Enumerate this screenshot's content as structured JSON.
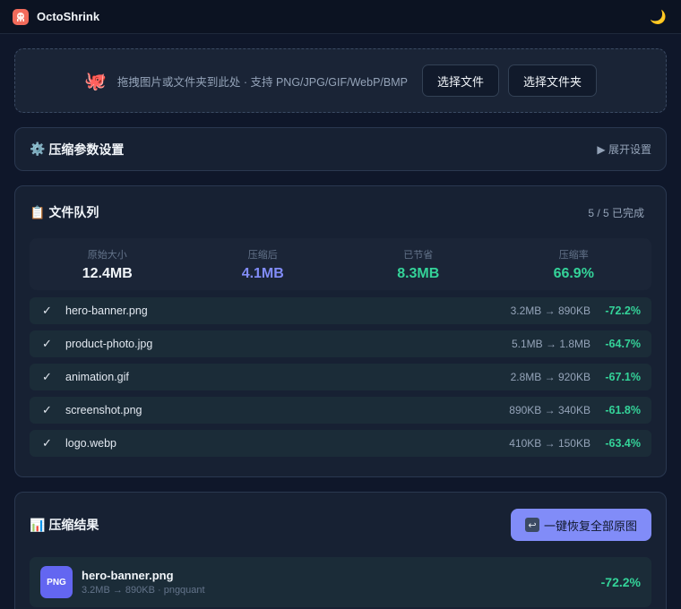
{
  "app": {
    "title": "OctoShrink",
    "theme_icon": "moon-icon"
  },
  "dropzone": {
    "icon": "octopus-icon",
    "text": "拖拽图片或文件夹到此处 · 支持 PNG/JPG/GIF/WebP/BMP",
    "select_file": "选择文件",
    "select_folder": "选择文件夹"
  },
  "settings": {
    "icon": "gear-icon",
    "title": "压缩参数设置",
    "expand": "▶ 展开设置"
  },
  "queue": {
    "icon": "clipboard-icon",
    "title": "文件队列",
    "count": "5 / 5 已完成",
    "stats": [
      {
        "label": "原始大小",
        "value": "12.4MB",
        "color": "#f1f5f9"
      },
      {
        "label": "压缩后",
        "value": "4.1MB",
        "color": "#818cf8"
      },
      {
        "label": "已节省",
        "value": "8.3MB",
        "color": "#34d399"
      },
      {
        "label": "压缩率",
        "value": "66.9%",
        "color": "#34d399"
      }
    ],
    "files": [
      {
        "check": "✓",
        "name": "hero-banner.png",
        "sizes": "3.2MB → 890KB",
        "pct": "-72.2%"
      },
      {
        "check": "✓",
        "name": "product-photo.jpg",
        "sizes": "5.1MB → 1.8MB",
        "pct": "-64.7%"
      },
      {
        "check": "✓",
        "name": "animation.gif",
        "sizes": "2.8MB → 920KB",
        "pct": "-67.1%"
      },
      {
        "check": "✓",
        "name": "screenshot.png",
        "sizes": "890KB → 340KB",
        "pct": "-61.8%"
      },
      {
        "check": "✓",
        "name": "logo.webp",
        "sizes": "410KB → 150KB",
        "pct": "-63.4%"
      }
    ]
  },
  "results": {
    "icon": "bar-chart-icon",
    "title": "压缩结果",
    "restore_label": "一键恢复全部原图",
    "items": [
      {
        "badge": "PNG",
        "name": "hero-banner.png",
        "meta": "3.2MB → 890KB · pngquant",
        "pct": "-72.2%"
      }
    ]
  }
}
